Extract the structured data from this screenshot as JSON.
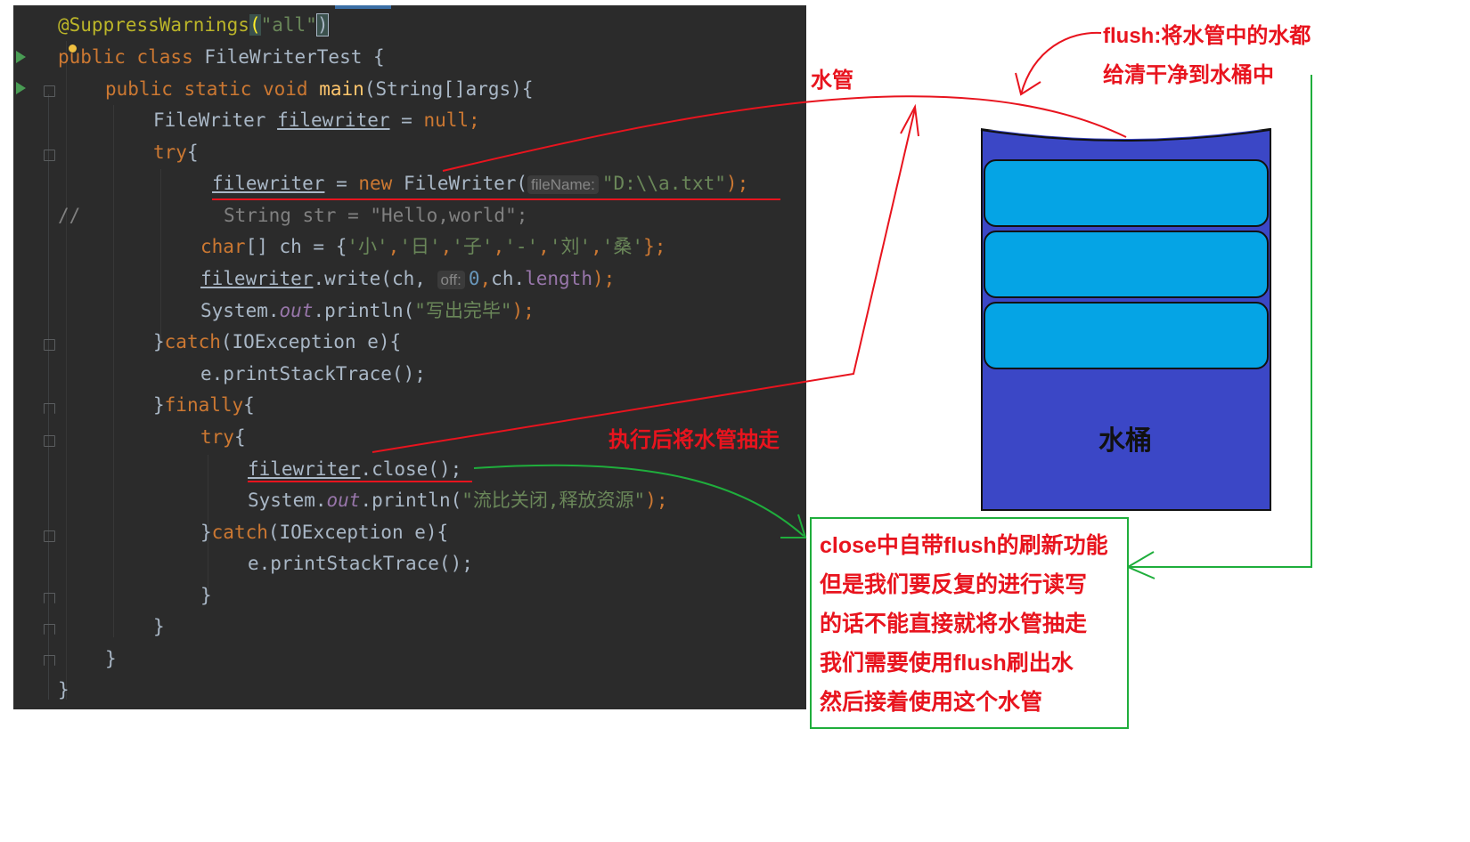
{
  "editor": {
    "lines": {
      "l1": {
        "annotation": "@SuppressWarnings",
        "open": "(",
        "str": "\"all\"",
        "close": ")"
      },
      "l2": {
        "kw": "public class",
        "rest": " FileWriterTest {"
      },
      "l3": {
        "kw": "public static void",
        "name": "main",
        "rest": "(String[]args){"
      },
      "l4": {
        "type": "FileWriter ",
        "var": "filewriter",
        "eq": " = ",
        "kw": "null",
        "semi": ";"
      },
      "l5": {
        "kw": "try",
        "rest": "{"
      },
      "l6": {
        "var": "filewriter",
        "eq": " = ",
        "kw": "new",
        "cls": " FileWriter(",
        "hint": "fileName:",
        "str": "\"D:\\\\a.txt\"",
        "end": ");"
      },
      "l7": {
        "slashes": "//",
        "text": "String str = \"Hello,world\";"
      },
      "l8": {
        "kw": "char",
        "mid": "[] ch = {",
        "s1": "'小'",
        "s2": "'日'",
        "s3": "'子'",
        "s4": "'-'",
        "s5": "'刘'",
        "s6": "'桑'",
        "comma": ",",
        "end": "};"
      },
      "l9": {
        "var": "filewriter",
        "mid": ".write(ch,",
        "hint": "off:",
        "num": "0",
        "comma": ",",
        "mid2": "ch.",
        "fld": "length",
        "end": ");"
      },
      "l10": {
        "obj": "System.",
        "fld": "out",
        "mid": ".println(",
        "str": "\"写出完毕\"",
        "end": ");"
      },
      "l11": {
        "brace": "}",
        "kw": "catch",
        "rest": "(IOException e){"
      },
      "l12": {
        "text": "e.printStackTrace();"
      },
      "l13": {
        "brace": "}",
        "kw": "finally",
        "rest": "{"
      },
      "l14": {
        "kw": "try",
        "rest": "{"
      },
      "l15": {
        "var": "filewriter",
        "rest": ".close();"
      },
      "l16": {
        "obj": "System.",
        "fld": "out",
        "mid": ".println(",
        "str": "\"流比关闭,释放资源\"",
        "end": ");"
      },
      "l17": {
        "brace": "}",
        "kw": "catch",
        "rest": "(IOException e){"
      },
      "l18": {
        "text": "e.printStackTrace();"
      },
      "l19": {
        "text": "}"
      },
      "l20": {
        "text": "}"
      },
      "l21": {
        "text": "}"
      },
      "l22": {
        "text": "}"
      }
    }
  },
  "annotations": {
    "pipe_label": "水管",
    "flush_line1": "flush:将水管中的水都",
    "flush_line2": "给清干净到水桶中",
    "remove_pipe": "执行后将水管抽走",
    "bucket_label": "水桶",
    "note": [
      "close中自带flush的刷新功能",
      "但是我们要反复的进行读写",
      "的话不能直接就将水管抽走",
      "我们需要使用flush刷出水",
      "然后接着使用这个水管"
    ]
  },
  "colors": {
    "editor_bg": "#2b2b2b",
    "annotation_red": "#e8141e",
    "arrow_green": "#1fae3c",
    "bucket_blue": "#3b47c6",
    "water_cyan": "#05a4e5"
  }
}
